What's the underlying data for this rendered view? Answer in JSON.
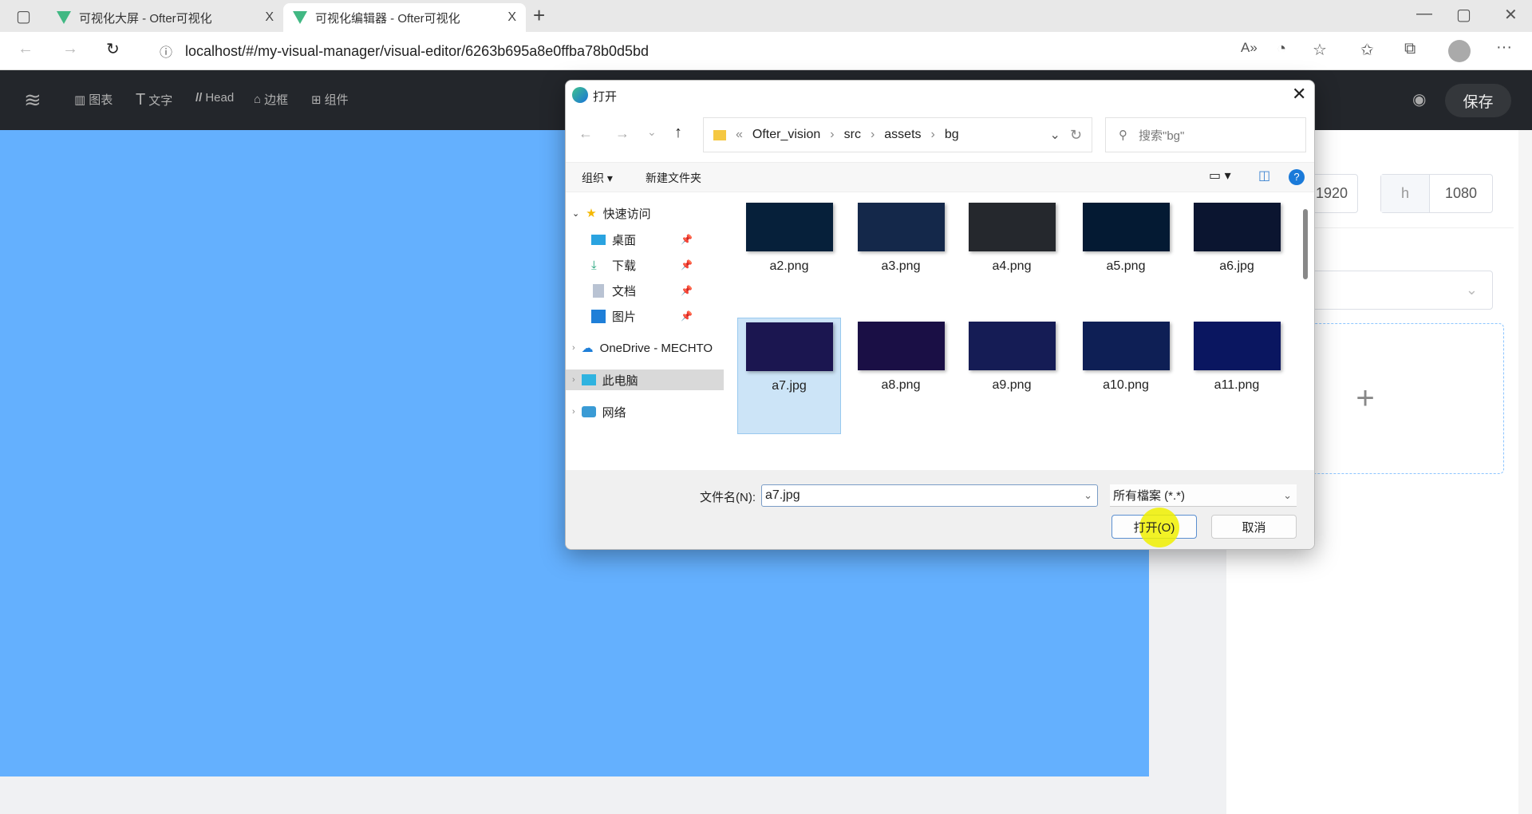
{
  "browser": {
    "tabs": [
      {
        "title": "可视化大屏 - Ofter可视化"
      },
      {
        "title": "可视化编辑器 - Ofter可视化"
      }
    ],
    "close": "X",
    "new_tab": "+",
    "url": "localhost/#/my-visual-manager/visual-editor/6263b695a8e0ffba78b0d5bd"
  },
  "toolbar": {
    "items": [
      {
        "label": "图表"
      },
      {
        "label": "文字"
      },
      {
        "label": "Head"
      },
      {
        "label": "边框"
      },
      {
        "label": "组件"
      }
    ],
    "save": "保存"
  },
  "panel": {
    "w_value": "1920",
    "h_label": "h",
    "h_value": "1080",
    "plus": "+"
  },
  "dialog": {
    "title": "打开",
    "path": [
      "Ofter_vision",
      "src",
      "assets",
      "bg"
    ],
    "search_placeholder": "搜索\"bg\"",
    "organize": "组织 ▾",
    "new_folder": "新建文件夹",
    "nav": [
      {
        "label": "快速访问"
      },
      {
        "label": "桌面"
      },
      {
        "label": "下载"
      },
      {
        "label": "文档"
      },
      {
        "label": "图片"
      },
      {
        "label": "OneDrive - MECHTO"
      },
      {
        "label": "此电脑"
      },
      {
        "label": "网络"
      }
    ],
    "files": [
      {
        "name": "a2.png",
        "color": "#06203a"
      },
      {
        "name": "a3.png",
        "color": "#14284a"
      },
      {
        "name": "a4.png",
        "color": "#25282d"
      },
      {
        "name": "a5.png",
        "color": "#041a33"
      },
      {
        "name": "a6.jpg",
        "color": "#0b1530"
      },
      {
        "name": "a7.jpg",
        "color": "#1b1650"
      },
      {
        "name": "a8.png",
        "color": "#1a0f45"
      },
      {
        "name": "a9.png",
        "color": "#151c55"
      },
      {
        "name": "a10.png",
        "color": "#0e1f55"
      },
      {
        "name": "a11.png",
        "color": "#0a1660"
      }
    ],
    "selected": "a7.jpg",
    "filename_label": "文件名(N):",
    "filename": "a7.jpg",
    "filter": "所有檔案 (*.*)",
    "open": "打开(O)",
    "cancel": "取消"
  }
}
